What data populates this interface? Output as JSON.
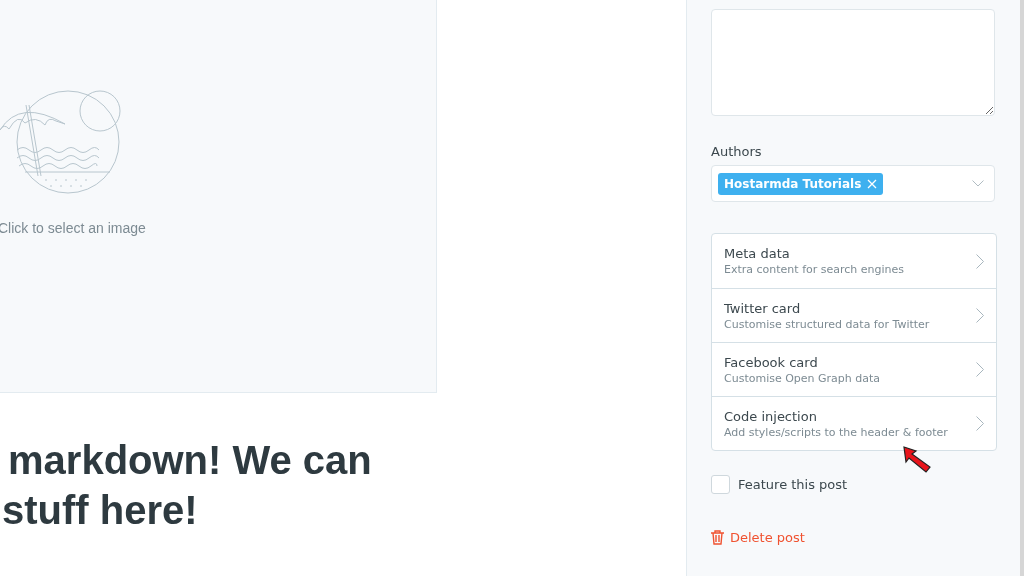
{
  "image_upload": {
    "hint": "Click to select an image"
  },
  "headline": {
    "lines": [
      "markdown! We can",
      "stuff here!"
    ]
  },
  "sidebar": {
    "authors": {
      "label": "Authors",
      "tags": [
        "Hostarmda Tutorials"
      ]
    },
    "menu": [
      {
        "title": "Meta data",
        "subtitle": "Extra content for search engines"
      },
      {
        "title": "Twitter card",
        "subtitle": "Customise structured data for Twitter"
      },
      {
        "title": "Facebook card",
        "subtitle": "Customise Open Graph data"
      },
      {
        "title": "Code injection",
        "subtitle": "Add styles/scripts to the header & footer"
      }
    ],
    "feature": {
      "label": "Feature this post",
      "checked": false
    },
    "delete": {
      "label": "Delete post"
    }
  }
}
